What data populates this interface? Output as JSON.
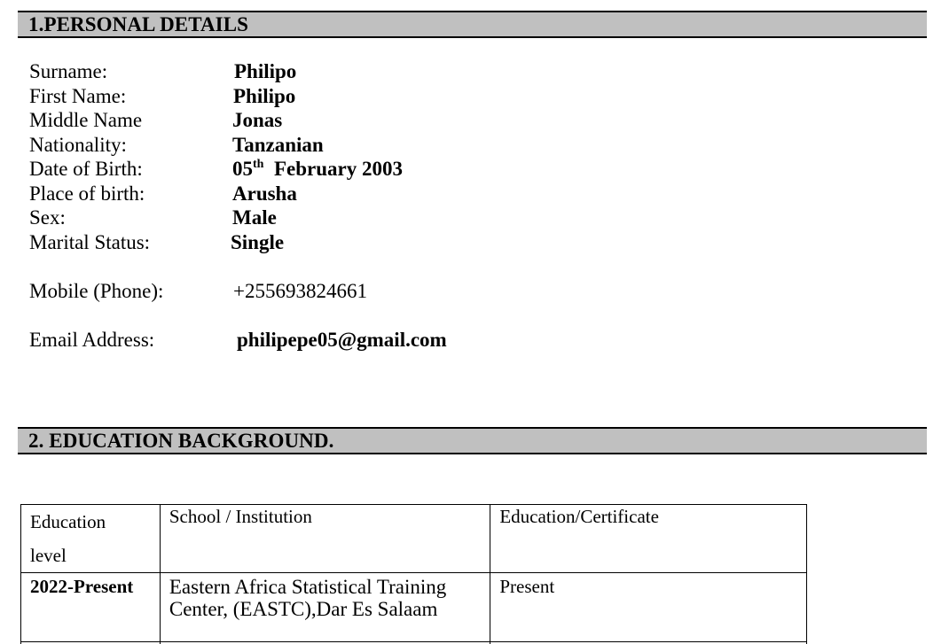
{
  "sections": {
    "personal_title": "1.PERSONAL DETAILS",
    "education_title": "2. EDUCATION BACKGROUND."
  },
  "personal": {
    "surname": {
      "label": "Surname:",
      "value": "Philipo"
    },
    "first_name": {
      "label": "First Name:",
      "value": "Philipo"
    },
    "middle_name": {
      "label": "Middle Name",
      "value": "Jonas"
    },
    "nationality": {
      "label": "Nationality:",
      "value": "Tanzanian"
    },
    "dob": {
      "label": "Date of Birth:",
      "day": "05",
      "suffix": "th",
      "rest": "February 2003"
    },
    "place_of_birth": {
      "label": "Place of birth:",
      "value": "Arusha"
    },
    "sex": {
      "label": "Sex:",
      "value": "Male"
    },
    "marital_status": {
      "label": "Marital Status:",
      "value": "Single"
    },
    "mobile": {
      "label": "Mobile (Phone):",
      "value": "+255693824661"
    },
    "email": {
      "label": "Email Address:",
      "value": "philipepe05@gmail.com"
    }
  },
  "education": {
    "headers": {
      "level_line1": "Education",
      "level_line2": "level",
      "school": "School / Institution",
      "certificate": "Education/Certificate"
    },
    "rows": [
      {
        "level": "2022-Present",
        "school_line1": "Eastern Africa Statistical Training",
        "school_line2": "Center, (EASTC),Dar Es Salaam",
        "certificate": "Present"
      }
    ]
  }
}
